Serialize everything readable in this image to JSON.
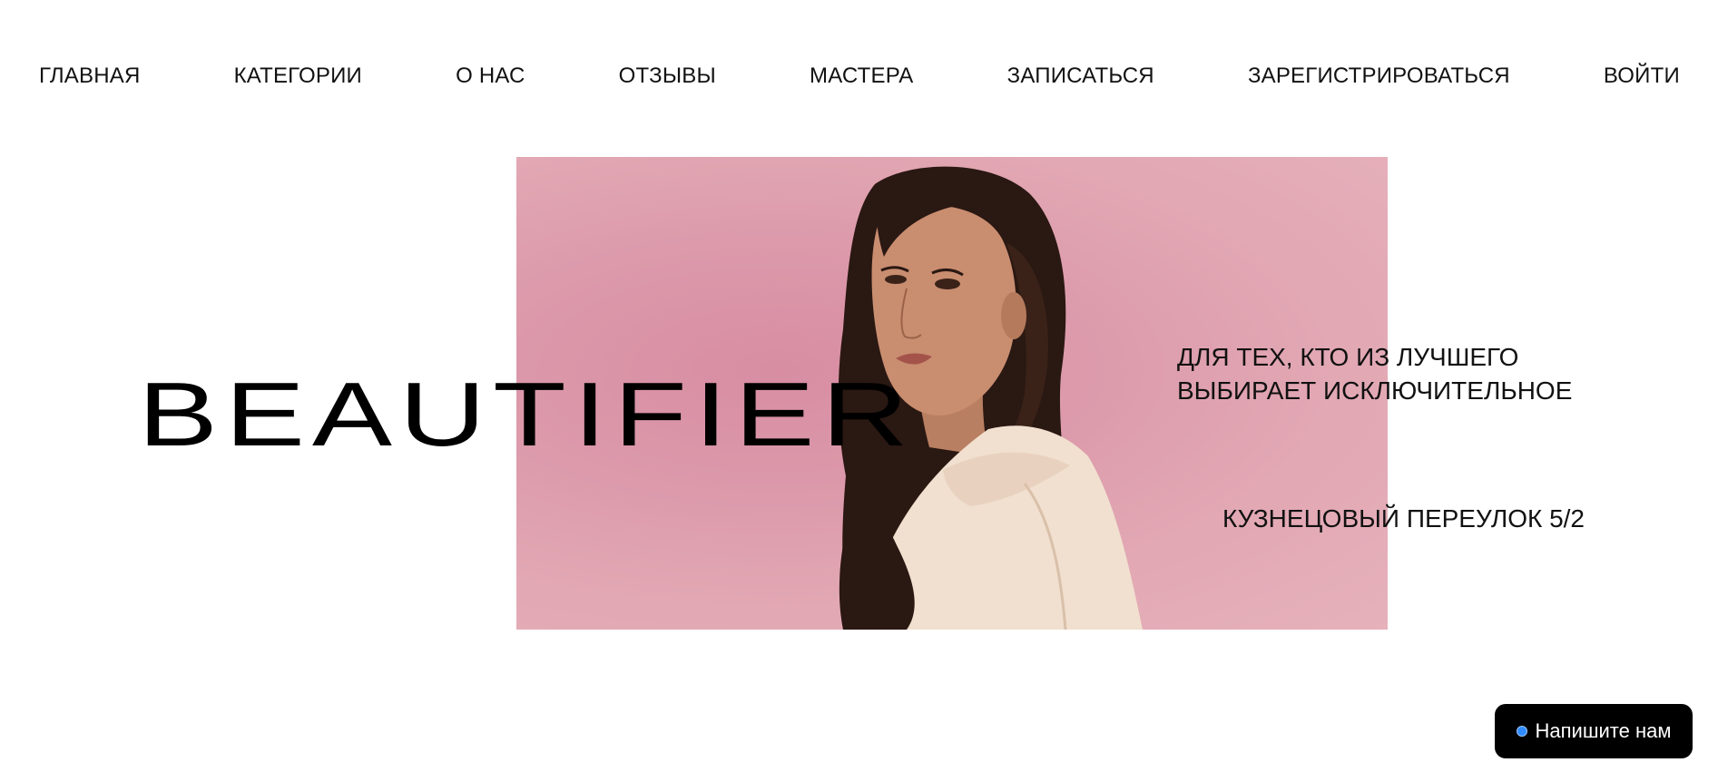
{
  "nav": {
    "items": [
      {
        "label": "ГЛАВНАЯ"
      },
      {
        "label": "КАТЕГОРИИ"
      },
      {
        "label": "О НАС"
      },
      {
        "label": "ОТЗЫВЫ"
      },
      {
        "label": "МАСТЕРА"
      },
      {
        "label": "ЗАПИСАТЬСЯ"
      },
      {
        "label": "ЗАРЕГИСТРИРОВАТЬСЯ"
      },
      {
        "label": "ВОЙТИ"
      }
    ]
  },
  "hero": {
    "brand": "BEAUTIFIER",
    "tagline": {
      "line1": "ДЛЯ ТЕХ, КТО ИЗ ЛУЧШЕГО",
      "line2": "ВЫБИРАЕТ ИСКЛЮЧИТЕЛЬНОЕ"
    },
    "address": "КУЗНЕЦОВЫЙ ПЕРЕУЛОК 5/2",
    "photo_icon": "woman-portrait-photo"
  },
  "chat": {
    "label": "Напишите нам",
    "icon": "status-dot-icon"
  },
  "colors": {
    "background": "#ffffff",
    "text": "#111111",
    "photo_pink": "#dc9aab",
    "chat_bg": "#000000",
    "chat_dot": "#2f8bff"
  }
}
